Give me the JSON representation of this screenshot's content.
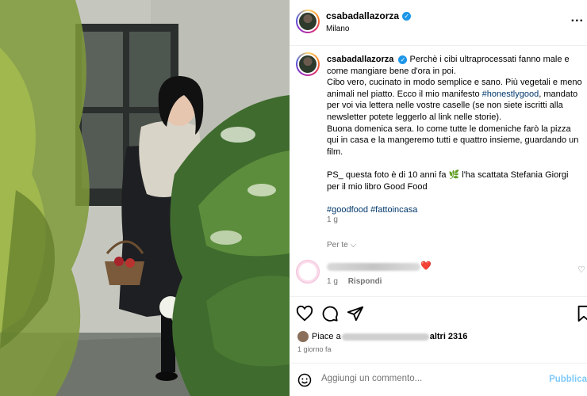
{
  "post": {
    "username": "csabadallazorza",
    "location": "Milano",
    "more_icon": "..."
  },
  "caption": {
    "username": "csabadallazorza",
    "lines": [
      "Perchè i cibi ultraprocessati fanno male e come mangiare bene d'ora in poi.",
      "Cibo vero, cucinato in modo semplice e sano. Più vegetali e meno animali nel piatto. Ecco il mio manifesto ",
      "#honestlygood",
      ", mandato per voi via lettera nelle vostre caselle (se non siete iscritti alla newsletter potete leggerlo al link nelle storie).",
      "Buona domenica sera. Io come tutte le domeniche farò la pizza qui in casa e la mangeremo tutti e quattro insieme, guardando un film.",
      "PS_ questa foto è di 10 anni fa 🌿 l'ha scattata Stefania Giorgi per il mio libro Good Food",
      "#goodfood",
      "#fattoincasa"
    ],
    "time": "1 g",
    "translate": "Per te ⌵"
  },
  "comment": {
    "heart": "❤️",
    "time": "1 g",
    "reply": "Rispondi"
  },
  "likes": {
    "prefix": "Piace a",
    "suffix": "altri 2316",
    "date": "1 giorno fa"
  },
  "add_comment": {
    "placeholder": "Aggiungi un commento...",
    "publish": "Pubblica"
  },
  "colors": {
    "link": "#00376b",
    "verified": "#1c96e8",
    "publish": "#0095f6",
    "heart": "#e0245e"
  }
}
